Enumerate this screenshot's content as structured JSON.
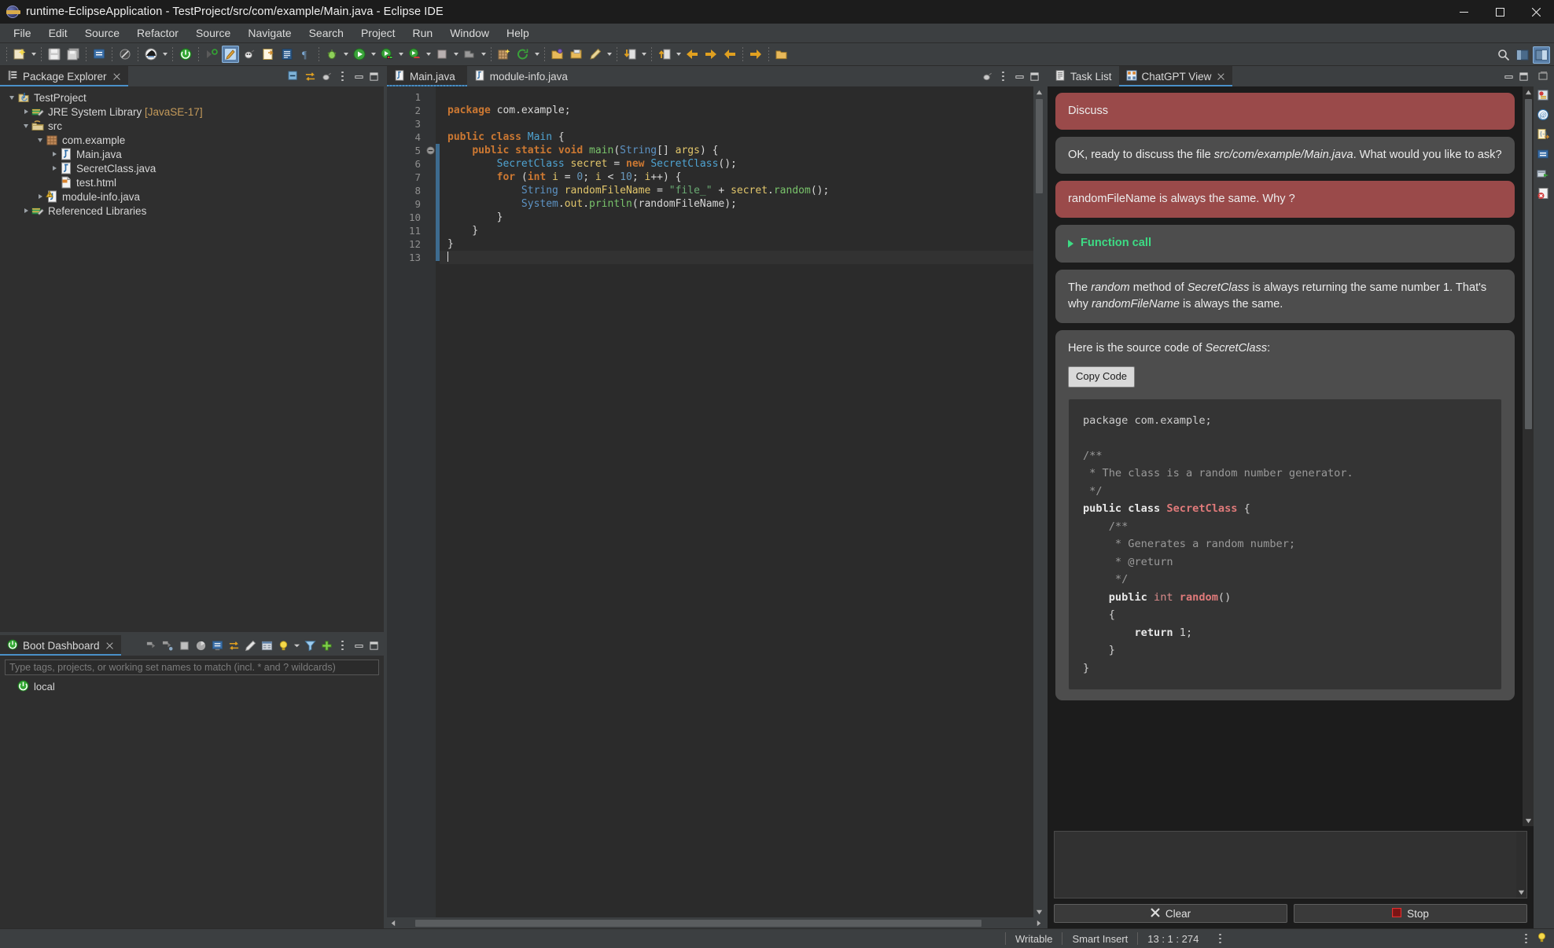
{
  "window": {
    "title": "runtime-EclipseApplication - TestProject/src/com/example/Main.java - Eclipse IDE",
    "app_icon": "eclipse-icon",
    "minimize": "minimize-button",
    "maximize": "maximize-button",
    "close": "close-button"
  },
  "menubar": {
    "items": [
      "File",
      "Edit",
      "Source",
      "Refactor",
      "Source",
      "Navigate",
      "Search",
      "Project",
      "Run",
      "Window",
      "Help"
    ]
  },
  "toolbar": {
    "items": [
      "new-wizard-icon",
      "save-icon",
      "save-all-icon",
      "new-java-file-icon",
      "skip-breakpoints-icon",
      "open-type-icon",
      "boot-run-icon",
      "next-annotation-icon",
      "toggle-markoccurrences-icon",
      "debug-java-icon",
      "external-tools-icon",
      "open-task-icon",
      "show-whitespace-icon",
      "debug-icon",
      "run-icon",
      "coverage-icon",
      "run-config-icon",
      "terminate-icon",
      "build-icon",
      "new-package-icon",
      "refresh-icon",
      "open-folder-icon",
      "import-icon",
      "edit-icon",
      "download-icon",
      "upload-icon",
      "back-icon",
      "forward-icon",
      "previous-edit-icon",
      "next-edit-icon",
      "open-perspective-icon"
    ],
    "search_icon": "search-icon",
    "perspective_java_icon": "java-perspective-icon",
    "perspective_debug_icon": "debug-perspective-icon"
  },
  "package_explorer": {
    "tab_label": "Package Explorer",
    "tab_icon": "package-explorer-icon",
    "toolbar": [
      "collapse-all-icon",
      "link-with-editor-icon",
      "view-menu-icon",
      "minimize-icon",
      "maximize-icon"
    ],
    "tree": [
      {
        "label": "TestProject",
        "suffix": "",
        "icon": "java-project-icon",
        "indent": 0,
        "twisty": "down"
      },
      {
        "label": "JRE System Library ",
        "suffix": "[JavaSE-17]",
        "icon": "library-icon",
        "indent": 1,
        "twisty": "right"
      },
      {
        "label": "src",
        "suffix": "",
        "icon": "source-folder-icon",
        "indent": 1,
        "twisty": "down"
      },
      {
        "label": "com.example",
        "suffix": "",
        "icon": "package-icon",
        "indent": 2,
        "twisty": "down"
      },
      {
        "label": "Main.java",
        "suffix": "",
        "icon": "java-file-icon",
        "indent": 3,
        "twisty": "right"
      },
      {
        "label": "SecretClass.java",
        "suffix": "",
        "icon": "java-file-icon",
        "indent": 3,
        "twisty": "right"
      },
      {
        "label": "test.html",
        "suffix": "",
        "icon": "html-file-icon",
        "indent": 3,
        "twisty": "none"
      },
      {
        "label": "module-info.java",
        "suffix": "",
        "icon": "module-info-warning-icon",
        "indent": 2,
        "twisty": "right"
      },
      {
        "label": "Referenced Libraries",
        "suffix": "",
        "icon": "library-icon",
        "indent": 1,
        "twisty": "right"
      }
    ]
  },
  "boot_dashboard": {
    "tab_label": "Boot Dashboard",
    "tab_icon": "boot-dashboard-icon",
    "filter_placeholder": "Type tags, projects, or working set names to match (incl. * and ? wildcards)",
    "toolbar": [
      "start-icon",
      "debug-icon",
      "stop-icon",
      "live-beans-icon",
      "open-console-icon",
      "refresh-icon",
      "edit-icon",
      "properties-icon",
      "lightbulb-icon",
      "dropdown-icon",
      "filter-icon",
      "add-icon",
      "view-menu-icon",
      "minimize-icon",
      "maximize-icon"
    ],
    "rows": [
      {
        "label": "local",
        "icon": "local-run-target-icon"
      }
    ]
  },
  "editor": {
    "tabs": [
      {
        "label": "Main.java",
        "icon": "java-file-icon",
        "active": true,
        "closable": true
      },
      {
        "label": "module-info.java",
        "icon": "java-file-icon",
        "active": false,
        "closable": false
      }
    ],
    "toolbar": [
      "link-editor-icon",
      "view-menu-icon",
      "minimize-icon",
      "maximize-icon"
    ],
    "gutter_marker_line": 5,
    "gutter_marker_icon": "collapse-method-icon",
    "lines": [
      {
        "n": 1,
        "tokens": []
      },
      {
        "n": 2,
        "tokens": [
          {
            "t": "package ",
            "c": "kw"
          },
          {
            "t": "com.example;",
            "c": "pln"
          }
        ]
      },
      {
        "n": 3,
        "tokens": []
      },
      {
        "n": 4,
        "tokens": [
          {
            "t": "public class ",
            "c": "kw"
          },
          {
            "t": "Main",
            "c": "cls"
          },
          {
            "t": " {",
            "c": "pln"
          }
        ]
      },
      {
        "n": 5,
        "tokens": [
          {
            "t": "    ",
            "c": "pln"
          },
          {
            "t": "public static void ",
            "c": "kw"
          },
          {
            "t": "main",
            "c": "mth"
          },
          {
            "t": "(",
            "c": "pln"
          },
          {
            "t": "String",
            "c": "typ"
          },
          {
            "t": "[] ",
            "c": "pln"
          },
          {
            "t": "args",
            "c": "fld"
          },
          {
            "t": ") {",
            "c": "pln"
          }
        ]
      },
      {
        "n": 6,
        "tokens": [
          {
            "t": "        ",
            "c": "pln"
          },
          {
            "t": "SecretClass",
            "c": "cls"
          },
          {
            "t": " ",
            "c": "pln"
          },
          {
            "t": "secret",
            "c": "fld"
          },
          {
            "t": " = ",
            "c": "pln"
          },
          {
            "t": "new ",
            "c": "kw"
          },
          {
            "t": "SecretClass",
            "c": "cls"
          },
          {
            "t": "();",
            "c": "pln"
          }
        ]
      },
      {
        "n": 7,
        "tokens": [
          {
            "t": "        ",
            "c": "pln"
          },
          {
            "t": "for ",
            "c": "kw"
          },
          {
            "t": "(",
            "c": "pln"
          },
          {
            "t": "int ",
            "c": "kw"
          },
          {
            "t": "i",
            "c": "fld"
          },
          {
            "t": " = ",
            "c": "pln"
          },
          {
            "t": "0",
            "c": "num"
          },
          {
            "t": "; ",
            "c": "pln"
          },
          {
            "t": "i",
            "c": "fld"
          },
          {
            "t": " < ",
            "c": "pln"
          },
          {
            "t": "10",
            "c": "num"
          },
          {
            "t": "; ",
            "c": "pln"
          },
          {
            "t": "i",
            "c": "fld"
          },
          {
            "t": "++) {",
            "c": "pln"
          }
        ]
      },
      {
        "n": 8,
        "tokens": [
          {
            "t": "            ",
            "c": "pln"
          },
          {
            "t": "String",
            "c": "typ"
          },
          {
            "t": " ",
            "c": "pln"
          },
          {
            "t": "randomFileName",
            "c": "fld"
          },
          {
            "t": " = ",
            "c": "pln"
          },
          {
            "t": "\"file_\"",
            "c": "str"
          },
          {
            "t": " + ",
            "c": "pln"
          },
          {
            "t": "secret",
            "c": "fld"
          },
          {
            "t": ".",
            "c": "pln"
          },
          {
            "t": "random",
            "c": "mth"
          },
          {
            "t": "();",
            "c": "pln"
          }
        ]
      },
      {
        "n": 9,
        "tokens": [
          {
            "t": "            ",
            "c": "pln"
          },
          {
            "t": "System",
            "c": "typ"
          },
          {
            "t": ".",
            "c": "pln"
          },
          {
            "t": "out",
            "c": "fld"
          },
          {
            "t": ".",
            "c": "pln"
          },
          {
            "t": "println",
            "c": "mth"
          },
          {
            "t": "(randomFileName);",
            "c": "pln"
          }
        ]
      },
      {
        "n": 10,
        "tokens": [
          {
            "t": "        }",
            "c": "pln"
          }
        ]
      },
      {
        "n": 11,
        "tokens": [
          {
            "t": "    }",
            "c": "pln"
          }
        ]
      },
      {
        "n": 12,
        "tokens": [
          {
            "t": "}",
            "c": "pln"
          }
        ]
      },
      {
        "n": 13,
        "tokens": [],
        "caret": true
      }
    ]
  },
  "right_panel": {
    "tabs": [
      {
        "label": "Task List",
        "icon": "task-list-icon",
        "active": false,
        "closable": false
      },
      {
        "label": "ChatGPT View",
        "icon": "chatgpt-view-icon",
        "active": true,
        "closable": true
      }
    ],
    "toolbar": [
      "minimize-icon",
      "maximize-icon"
    ]
  },
  "chat": {
    "messages": [
      {
        "role": "user",
        "type": "text",
        "text": "Discuss"
      },
      {
        "role": "assistant",
        "type": "rich",
        "parts": [
          {
            "t": "OK, ready to discuss the file ",
            "i": false
          },
          {
            "t": "src/com/example/Main.java",
            "i": true
          },
          {
            "t": ". What would you like to ask?",
            "i": false
          }
        ]
      },
      {
        "role": "user",
        "type": "text",
        "text": "randomFileName is always the same. Why ?"
      },
      {
        "role": "function",
        "type": "function",
        "text": "Function call",
        "expander": "collapsed-triangle-icon"
      },
      {
        "role": "assistant",
        "type": "rich",
        "parts": [
          {
            "t": "The ",
            "i": false
          },
          {
            "t": "random",
            "i": true
          },
          {
            "t": " method of ",
            "i": false
          },
          {
            "t": "SecretClass",
            "i": true
          },
          {
            "t": " is always returning the same number 1. That's why ",
            "i": false
          },
          {
            "t": "randomFileName",
            "i": true
          },
          {
            "t": " is always the same.",
            "i": false
          }
        ]
      },
      {
        "role": "assistant",
        "type": "rich",
        "parts": [
          {
            "t": "Here is the source code of ",
            "i": false
          },
          {
            "t": "SecretClass",
            "i": true
          },
          {
            "t": ":",
            "i": false
          }
        ]
      }
    ],
    "copy_code_label": "Copy Code",
    "code_block": [
      [
        {
          "t": "package com.example;",
          "c": ""
        }
      ],
      [],
      [
        {
          "t": "/**",
          "c": "cb-cmt"
        }
      ],
      [
        {
          "t": " * The class is a random number generator.",
          "c": "cb-cmt"
        }
      ],
      [
        {
          "t": " */",
          "c": "cb-cmt"
        }
      ],
      [
        {
          "t": "public class ",
          "c": "cb-kw"
        },
        {
          "t": "SecretClass",
          "c": "cb-cls"
        },
        {
          "t": " {",
          "c": ""
        }
      ],
      [
        {
          "t": "    /**",
          "c": "cb-cmt"
        }
      ],
      [
        {
          "t": "     * Generates a random number;",
          "c": "cb-cmt"
        }
      ],
      [
        {
          "t": "     * @return",
          "c": "cb-cmt"
        }
      ],
      [
        {
          "t": "     */",
          "c": "cb-cmt"
        }
      ],
      [
        {
          "t": "    public ",
          "c": "cb-kw"
        },
        {
          "t": "int ",
          "c": "cb-ty"
        },
        {
          "t": "random",
          "c": "cb-cls"
        },
        {
          "t": "()",
          "c": ""
        }
      ],
      [
        {
          "t": "    {",
          "c": ""
        }
      ],
      [
        {
          "t": "        return ",
          "c": "cb-kw"
        },
        {
          "t": "1;",
          "c": ""
        }
      ],
      [
        {
          "t": "    }",
          "c": ""
        }
      ],
      [
        {
          "t": "}",
          "c": ""
        }
      ]
    ],
    "input_value": "",
    "buttons": [
      {
        "label": "Clear",
        "icon": "clear-x-icon"
      },
      {
        "label": "Stop",
        "icon": "stop-square-icon"
      }
    ]
  },
  "icon_rail": {
    "items": [
      "restore-icon",
      "properties-view-icon",
      "javadoc-view-icon",
      "declaration-view-icon",
      "console-view-icon",
      "servers-view-icon",
      "problems-view-icon"
    ]
  },
  "statusbar": {
    "writable": "Writable",
    "insert_mode": "Smart Insert",
    "position": "13 : 1 : 274",
    "menu_icon": "status-menu-icon",
    "tip_icon": "lightbulb-icon"
  },
  "colors": {
    "accent": "#4a90c8",
    "user_bubble": "#9a4a4a",
    "assistant_bubble": "#4d4d4d",
    "function_green": "#3ddc84",
    "chrome": "#3c3f41",
    "editor_bg": "#2b2b2b"
  }
}
